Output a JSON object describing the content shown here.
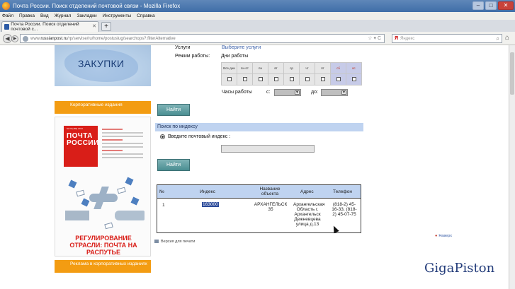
{
  "window": {
    "title": "Почта России. Поиск отделений почтовой связи - Mozilla Firefox"
  },
  "menu": [
    "Файл",
    "Правка",
    "Вид",
    "Журнал",
    "Закладки",
    "Инструменты",
    "Справка"
  ],
  "tab": {
    "label": "Почта России. Поиск отделений почтовой с..."
  },
  "address": {
    "prefix": "www.",
    "domain": "russianpost.ru",
    "path": "/rp/servise/ru/home/postuslug/searchops?.filterAlternative",
    "search_placeholder": "Яндекс",
    "search_engine": "Я"
  },
  "sidebar": {
    "banner_text": "ЗАКУПКИ",
    "corp_pubs_title": "Корпоративные издания",
    "magazine": {
      "header": "ПОЧТА РОССИИ",
      "top_line": "№ 09 (169) 2013",
      "cover_headline": "РЕГУЛИРОВАНИЕ ОТРАСЛИ: ПОЧТА НА РАСПУТЬЕ"
    },
    "ads_title": "Реклама в корпоративных изданиях"
  },
  "form": {
    "services_label": "Услуги",
    "services_link": "Выберите услуги",
    "mode_label": "Режим работы:",
    "days_label": "Дни работы",
    "days": [
      "Все дни",
      "пн-пт",
      "пн",
      "вт",
      "ср",
      "чт",
      "пт",
      "сб",
      "вс"
    ],
    "hours_label": "Часы работы",
    "from_label": "с:",
    "to_label": "до:",
    "find_button": "Найти"
  },
  "index_search": {
    "title": "Поиск по индексу",
    "radio_label": "Введите почтовый индекс :",
    "find_button": "Найти"
  },
  "results": {
    "headers": [
      "№",
      "Индекс",
      "Название объекта",
      "Адрес",
      "Телефон"
    ],
    "row": {
      "num": "1",
      "index": "163000",
      "name": "АРХАНГЕЛЬСК 35",
      "address": "Архангельская Область г. Архангельск Дежневцева улица д.13",
      "phone": "(818-2) 45-16-33, (818-2) 45-07-75"
    }
  },
  "print_link": "Версия для печати",
  "back_link": "Наверх",
  "watermark": "GigaPiston"
}
